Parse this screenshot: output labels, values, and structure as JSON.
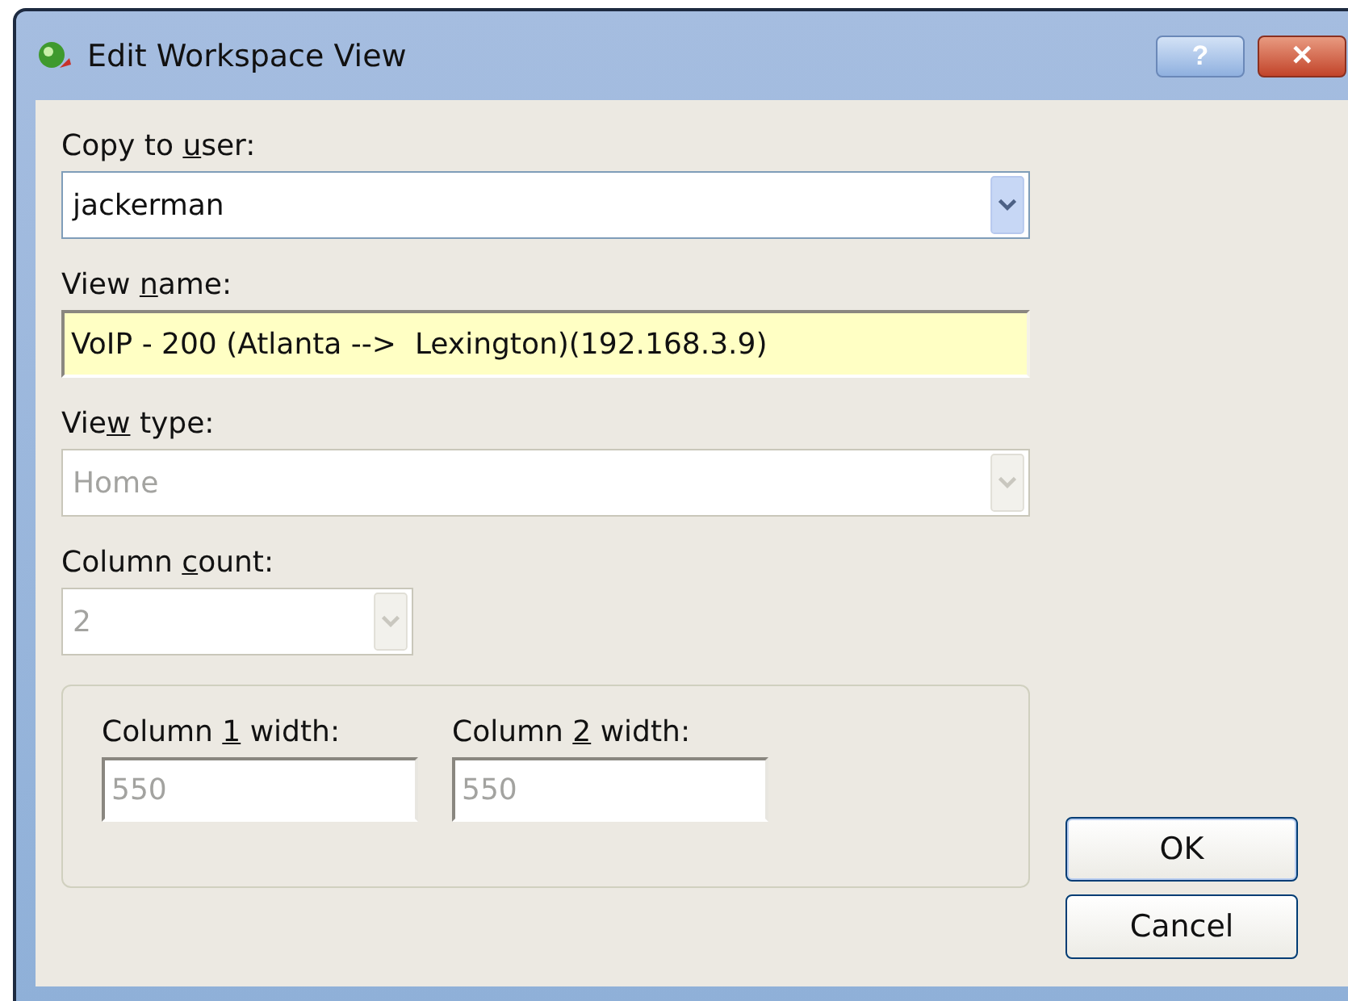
{
  "window": {
    "title": "Edit Workspace View",
    "buttons": [
      {
        "kind": "help",
        "glyph": "?"
      },
      {
        "kind": "close",
        "glyph": "✕"
      }
    ]
  },
  "copy_to_user": {
    "label": {
      "before": "Copy to ",
      "key": "u",
      "after": "ser:"
    },
    "value": "jackerman",
    "disabled": false
  },
  "view_name": {
    "label": {
      "before": "View ",
      "key": "n",
      "after": "ame:"
    },
    "value": "VoIP - 200 (Atlanta -->  Lexington)(192.168.3.9)",
    "focused": true
  },
  "view_type": {
    "label": {
      "before": "Vie",
      "key": "w",
      "after": " type:"
    },
    "value": "Home",
    "disabled": true
  },
  "column_count": {
    "label": {
      "before": "Column ",
      "key": "c",
      "after": "ount:"
    },
    "value": "2",
    "disabled": true
  },
  "column_widths": [
    {
      "label": {
        "before": "Column ",
        "key": "1",
        "after": " width:"
      },
      "value": "550",
      "disabled": true
    },
    {
      "label": {
        "before": "Column ",
        "key": "2",
        "after": " width:"
      },
      "value": "550",
      "disabled": true
    }
  ],
  "buttons": [
    {
      "label": "OK",
      "kind": "default"
    },
    {
      "label": "Cancel",
      "kind": "normal"
    }
  ]
}
